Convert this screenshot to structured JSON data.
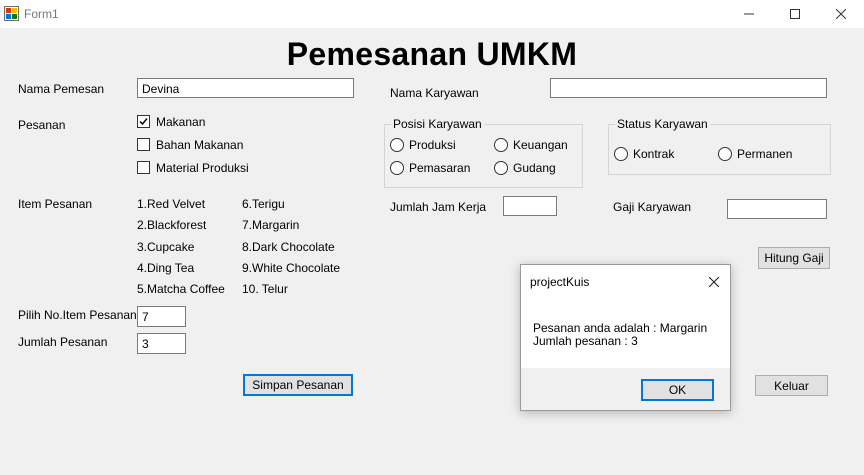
{
  "window": {
    "title": "Form1"
  },
  "form": {
    "title": "Pemesanan UMKM",
    "nama_pemesan_label": "Nama Pemesan",
    "nama_pemesan_value": "Devina",
    "pesanan_label": "Pesanan",
    "pesanan_options": [
      {
        "label": "Makanan",
        "checked": true
      },
      {
        "label": "Bahan Makanan",
        "checked": false
      },
      {
        "label": "Material Produksi",
        "checked": false
      }
    ],
    "item_pesanan_label": "Item Pesanan",
    "items_col1": [
      "1.Red Velvet",
      "2.Blackforest",
      "3.Cupcake",
      "4.Ding Tea",
      "5.Matcha Coffee"
    ],
    "items_col2": [
      "6.Terigu",
      "7.Margarin",
      "8.Dark Chocolate",
      "9.White Chocolate",
      "10. Telur"
    ],
    "pilih_no_label": "Pilih No.Item Pesanan",
    "pilih_no_value": "7",
    "jumlah_pesanan_label": "Jumlah Pesanan",
    "jumlah_pesanan_value": "3",
    "simpan_button": "Simpan Pesanan",
    "nama_karyawan_label": "Nama Karyawan",
    "nama_karyawan_value": "",
    "posisi_group_title": "Posisi Karyawan",
    "posisi_options": [
      "Produksi",
      "Keuangan",
      "Pemasaran",
      "Gudang"
    ],
    "status_group_title": "Status Karyawan",
    "status_options": [
      "Kontrak",
      "Permanen"
    ],
    "jam_kerja_label": "Jumlah Jam Kerja",
    "jam_kerja_value": "",
    "gaji_label": "Gaji Karyawan",
    "gaji_value": "",
    "hitung_button": "Hitung Gaji",
    "keluar_button": "Keluar"
  },
  "dialog": {
    "title": "projectKuis",
    "line1": "Pesanan anda adalah : Margarin",
    "line2": "Jumlah pesanan : 3",
    "ok_button": "OK"
  }
}
